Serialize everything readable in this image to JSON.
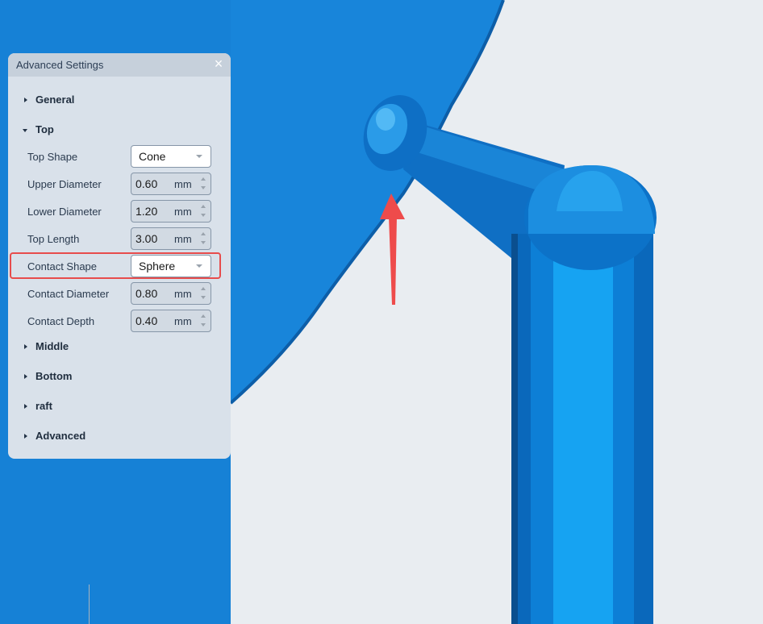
{
  "panel": {
    "title": "Advanced Settings",
    "close_icon": "×",
    "sections": {
      "general": "General",
      "top": "Top",
      "middle": "Middle",
      "bottom": "Bottom",
      "raft": "raft",
      "advanced": "Advanced"
    },
    "top_fields": {
      "top_shape": {
        "label": "Top Shape",
        "value": "Cone"
      },
      "upper_diameter": {
        "label": "Upper Diameter",
        "value": "0.60",
        "unit": "mm"
      },
      "lower_diameter": {
        "label": "Lower Diameter",
        "value": "1.20",
        "unit": "mm"
      },
      "top_length": {
        "label": "Top Length",
        "value": "3.00",
        "unit": "mm"
      },
      "contact_shape": {
        "label": "Contact Shape",
        "value": "Sphere"
      },
      "contact_diameter": {
        "label": "Contact Diameter",
        "value": "0.80",
        "unit": "mm"
      },
      "contact_depth": {
        "label": "Contact Depth",
        "value": "0.40",
        "unit": "mm"
      }
    }
  },
  "colors": {
    "background": "#e9edf1",
    "model_blue": "#1681d6",
    "support_blue": "#0a74cf",
    "highlight_red": "#e74c4c"
  },
  "icons": {
    "close": "close-icon",
    "expand": "triangle-right-icon",
    "collapse": "triangle-down-icon",
    "dropdown": "caret-down-icon",
    "stepper": "spin-arrows-icon"
  }
}
